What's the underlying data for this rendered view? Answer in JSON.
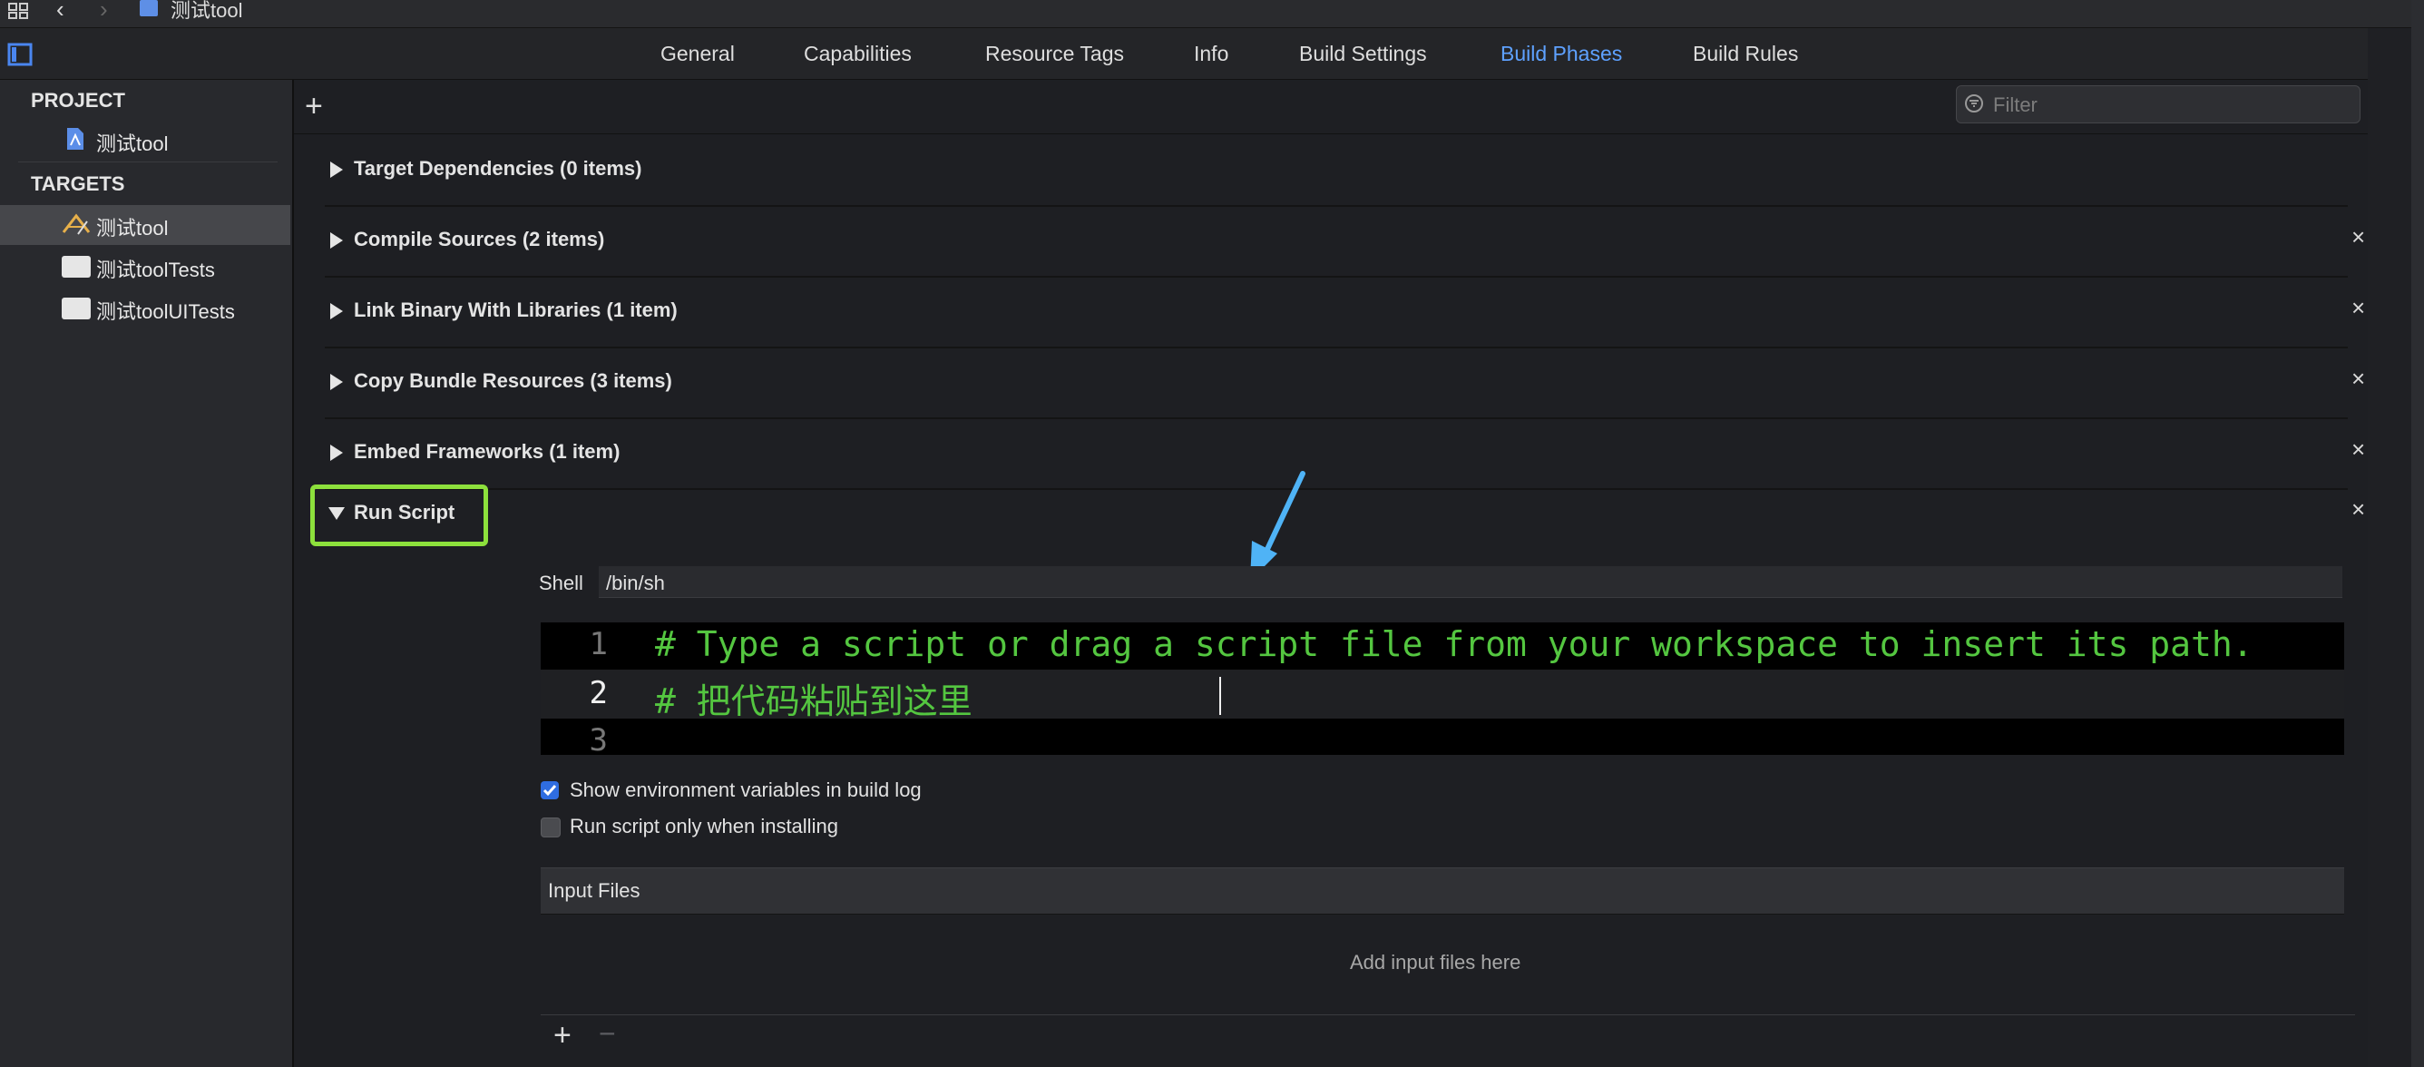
{
  "breadcrumb": {
    "title": "测试tool"
  },
  "tabs": [
    {
      "label": "General"
    },
    {
      "label": "Capabilities"
    },
    {
      "label": "Resource Tags"
    },
    {
      "label": "Info"
    },
    {
      "label": "Build Settings"
    },
    {
      "label": "Build Phases",
      "active": true
    },
    {
      "label": "Build Rules"
    }
  ],
  "sidebar": {
    "project_header": "PROJECT",
    "project_item": "测试tool",
    "targets_header": "TARGETS",
    "targets": [
      {
        "label": "测试tool",
        "selected": true
      },
      {
        "label": "测试toolTests"
      },
      {
        "label": "测试toolUITests"
      }
    ]
  },
  "filter": {
    "placeholder": "Filter"
  },
  "phases": [
    {
      "label": "Target Dependencies (0 items)",
      "closable": false
    },
    {
      "label": "Compile Sources (2 items)",
      "closable": true
    },
    {
      "label": "Link Binary With Libraries (1 item)",
      "closable": true
    },
    {
      "label": "Copy Bundle Resources (3 items)",
      "closable": true
    },
    {
      "label": "Embed Frameworks (1 item)",
      "closable": true
    },
    {
      "label": "Run Script",
      "closable": true,
      "expanded": true
    }
  ],
  "close_glyph": "×",
  "run_script": {
    "shell_label": "Shell",
    "shell_value": "/bin/sh",
    "code_lines": [
      {
        "num": "1",
        "text": "# Type a script or drag a script file from your workspace to insert its path."
      },
      {
        "num": "2",
        "text": "# 把代码粘贴到这里"
      },
      {
        "num": "3",
        "text": ""
      }
    ],
    "option_env": {
      "label": "Show environment variables in build log",
      "checked": true
    },
    "option_install": {
      "label": "Run script only when installing",
      "checked": false
    },
    "input_files_header": "Input Files",
    "input_files_placeholder": "Add input files here"
  },
  "colors": {
    "accent": "#5ea1ff",
    "highlight_box": "#8de03c",
    "arrow": "#4fb3f6",
    "code_text": "#54c640"
  }
}
